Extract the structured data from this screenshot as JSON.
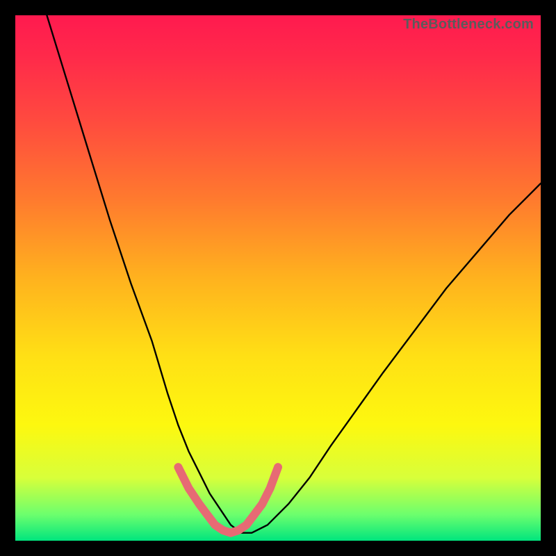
{
  "watermark": "TheBottleneck.com",
  "chart_data": {
    "type": "line",
    "title": "",
    "xlabel": "",
    "ylabel": "",
    "xlim": [
      0,
      100
    ],
    "ylim": [
      0,
      100
    ],
    "series": [
      {
        "name": "black-curve",
        "color": "#000000",
        "x": [
          6,
          10,
          14,
          18,
          22,
          26,
          29,
          31,
          33,
          35,
          37,
          39,
          41,
          43,
          45,
          48,
          52,
          56,
          60,
          65,
          70,
          76,
          82,
          88,
          94,
          100
        ],
        "y": [
          100,
          87,
          74,
          61,
          49,
          38,
          28,
          22,
          17,
          13,
          9,
          6,
          3,
          1.5,
          1.5,
          3,
          7,
          12,
          18,
          25,
          32,
          40,
          48,
          55,
          62,
          68
        ]
      },
      {
        "name": "pink-bottom-arc",
        "color": "#e76a74",
        "x": [
          31,
          33,
          35,
          36.5,
          38,
          39.5,
          41,
          42.5,
          44,
          45.5,
          47,
          48.5,
          50
        ],
        "y": [
          14,
          10,
          7,
          5,
          3,
          2,
          1.5,
          2,
          3,
          5,
          7,
          10,
          14
        ]
      }
    ],
    "notes": "Values are approximate; chart has no visible axes or ticks. y=0 is the bottom edge."
  }
}
